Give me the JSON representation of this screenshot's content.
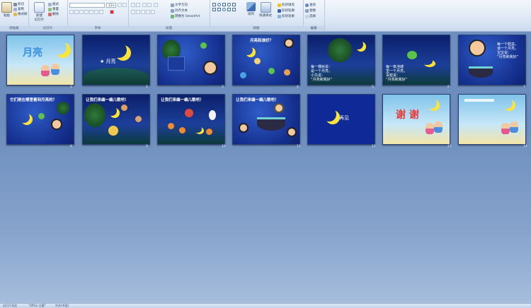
{
  "ribbon": {
    "groups": [
      {
        "name": "剪贴板",
        "paste": "粘贴",
        "cut": "剪切",
        "copy": "复制",
        "format_painter": "格式刷"
      },
      {
        "name": "幻灯片",
        "new_slide": "新建\n幻灯片",
        "layout": "版式",
        "reset": "重置",
        "delete": "删除"
      },
      {
        "name": "字体",
        "font_name": "",
        "font_size": "13+"
      },
      {
        "name": "段落",
        "text_direction": "文字方向",
        "align_text": "对齐文本",
        "smartart": "转换为 SmartArt"
      },
      {
        "name": "绘图",
        "arrange": "排列",
        "quick_styles": "快速样式",
        "shape_fill": "形状填充",
        "shape_outline": "形状轮廓",
        "shape_effects": "形状效果"
      },
      {
        "name": "编辑",
        "find": "查找",
        "replace": "替换",
        "select": "选择"
      }
    ]
  },
  "slides": [
    {
      "num": "1",
      "title": "月亮",
      "kind": "cover"
    },
    {
      "num": "2",
      "text": "★ 月亮",
      "kind": "moon"
    },
    {
      "num": "3",
      "kind": "frog_baby"
    },
    {
      "num": "4",
      "title": "月亮和谁好？",
      "kind": "friends"
    },
    {
      "num": "5",
      "lines": [
        "每一棵树说：",
        "是一个月亮，",
        "小鸟说：",
        "“月亮和我好”"
      ],
      "kind": "tree"
    },
    {
      "num": "6",
      "lines": [
        "每一条池塘",
        "里一个月亮，",
        "青蛙说：",
        "“月亮和我好”"
      ],
      "kind": "pond"
    },
    {
      "num": "7",
      "lines": [
        "每一个脸盆，",
        "滚一个月亮，",
        "宝宝说：",
        "“月亮和我好”"
      ],
      "kind": "basin"
    },
    {
      "num": "8",
      "title": "它们是在哪里看到月亮的？",
      "kind": "where"
    },
    {
      "num": "9",
      "title": "让我们来编一编儿歌吧！",
      "kind": "forest"
    },
    {
      "num": "10",
      "title": "让我们来编一编儿歌吧！",
      "kind": "animals"
    },
    {
      "num": "11",
      "title": "让我们来编一编儿歌吧！",
      "kind": "bowl"
    },
    {
      "num": "12",
      "text": "再见",
      "kind": "bye"
    },
    {
      "num": "13",
      "title": "谢 谢",
      "kind": "thanks"
    },
    {
      "num": "14",
      "kind": "end"
    }
  ],
  "status": {
    "left": "幻灯片浏览",
    "theme": "\"Office 主题\"",
    "language": "中文(中国)"
  },
  "colors": {
    "moon": "#ffe437",
    "slide_bg": "#15308f",
    "title_red": "#e53a3a"
  }
}
